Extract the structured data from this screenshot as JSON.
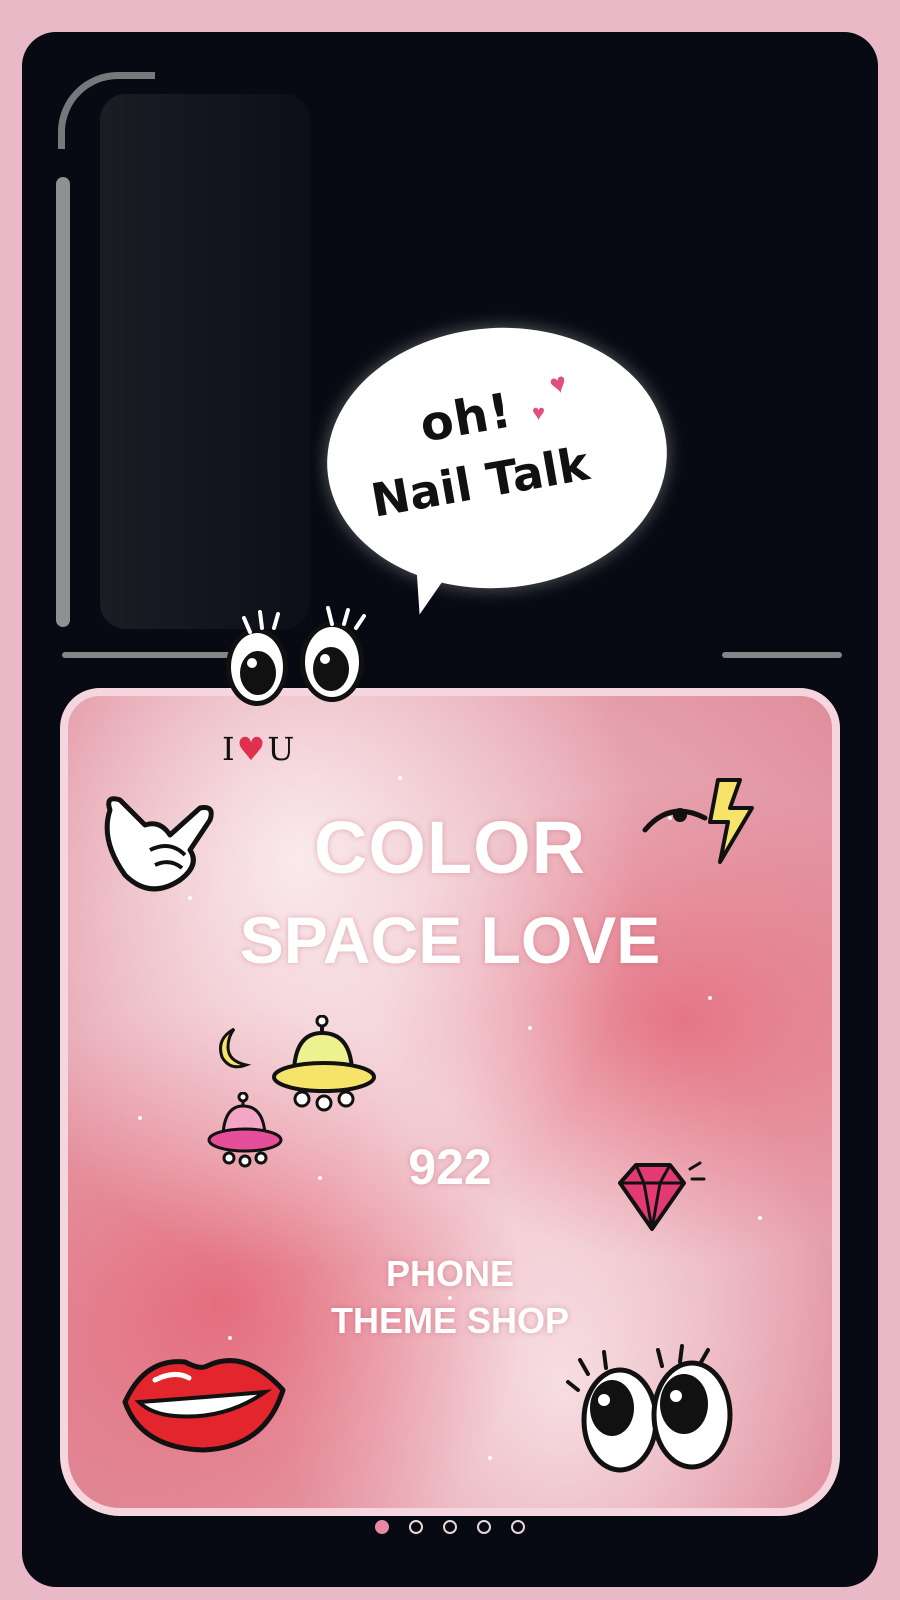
{
  "bubble": {
    "line1": "oh!",
    "line2": "Nail Talk"
  },
  "sticker_text": {
    "i_love_you_i": "I",
    "i_love_you_heart": "♥",
    "i_love_you_u": "U"
  },
  "product": {
    "title_line1": "COLOR",
    "title_line2": "SPACE LOVE",
    "number": "922",
    "brand_line1": "PHONE",
    "brand_line2": "THEME SHOP"
  },
  "pager": {
    "total_pages": 5,
    "current_page": 1
  },
  "colors": {
    "background": "#e9b9c8",
    "bottle": "#070a12",
    "pager_active": "#e58aa1"
  }
}
